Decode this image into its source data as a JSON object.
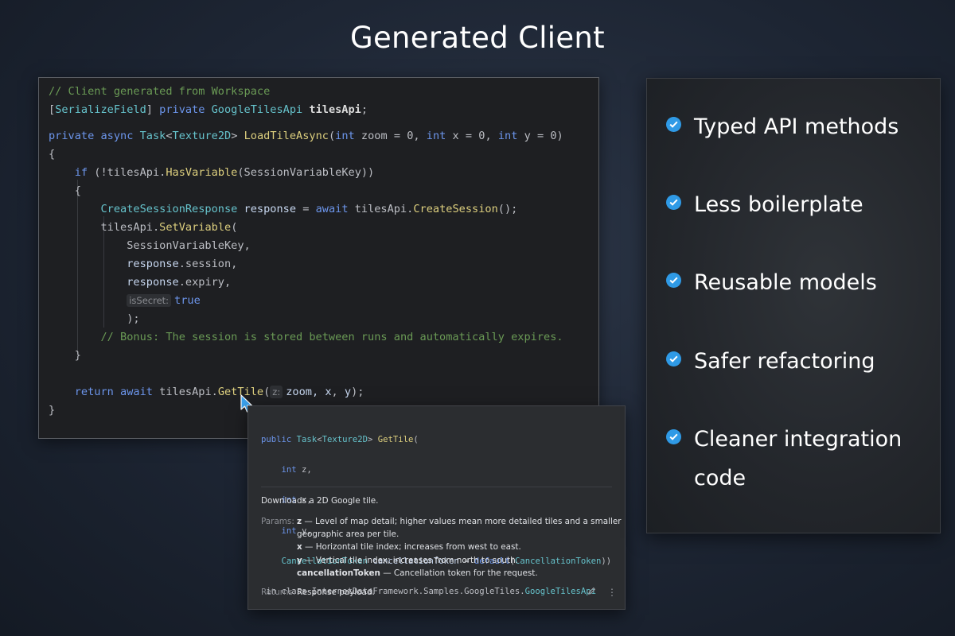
{
  "title": "Generated Client",
  "editor": {
    "l1_comment": "// Client generated from Workspace",
    "l2_open": "[",
    "l2_attr": "SerializeField",
    "l2_close": "] ",
    "l2_kw": "private",
    "l2_type": "GoogleTilesApi",
    "l2_field": "tilesApi",
    "l2_semi": ";",
    "l3_kw1": "private",
    "l3_kw2": "async",
    "l3_task": "Task",
    "l3_lt": "<",
    "l3_tex": "Texture2D",
    "l3_gt": "> ",
    "l3_fn": "LoadTileAsync",
    "l3_p1": "(",
    "l3_int1": "int",
    "l3_zoom": "zoom",
    "l3_eq0": " = 0, ",
    "l3_int2": "int",
    "l3_x": "x",
    "l3_eq1": " = 0, ",
    "l3_int3": "int",
    "l3_y": "y",
    "l3_eq2": " = 0)",
    "brace_open": "{",
    "brace_close": "}",
    "l5_if": "if",
    "l5_a": " (!tilesApi.",
    "l5_fn": "HasVariable",
    "l5_b": "(SessionVariableKey))",
    "l7_type": "CreateSessionResponse",
    "l7_var": "response",
    "l7_eq": " = ",
    "l7_await": "await",
    "l7_a": " tilesApi.",
    "l7_fn": "CreateSession",
    "l7_b": "();",
    "l8_a": "tilesApi.",
    "l8_fn": "SetVariable",
    "l8_b": "(",
    "l9": "SessionVariableKey,",
    "l10_var": "response",
    "l10_rest": ".session,",
    "l11_var": "response",
    "l11_rest": ".expiry,",
    "l12_hint": "isSecret:",
    "l12_val": "true",
    "l13": ");",
    "l14_comment": "// Bonus: The session is stored between runs and automatically expires.",
    "l16_ret": "return",
    "l16_await": "await",
    "l16_a": " tilesApi.",
    "l16_fn": "GetTile",
    "l16_b": "(",
    "l16_hint": "z:",
    "l16_c": "zoom, ",
    "l16_x": "x",
    "l16_comma": ", ",
    "l16_y": "y",
    "l16_d": ");"
  },
  "popup": {
    "s1_kw": "public",
    "s1_task": "Task",
    "s1_lt": "<",
    "s1_tex": "Texture2D",
    "s1_gt": ">",
    "s1_fn": "GetTile",
    "s1_p": "(",
    "s2_int": "int",
    "s2_n": "z,",
    "s3_int": "int",
    "s3_n": "x,",
    "s4_int": "int",
    "s4_n": "y,",
    "s5_type": "CancellationToken",
    "s5_name": "cancellationToken",
    "s5_eq": " = ",
    "s5_def": "default",
    "s5_p": "(",
    "s5_type2": "CancellationToken",
    "s5_close": "))",
    "s6_in": "in class InternetDataFramework.Samples.GoogleTiles.",
    "s6_cls": "GoogleTilesApi",
    "description": "Downloads a 2D Google tile.",
    "params_label": "Params:",
    "p_z_name": "z",
    "p_z_desc": " — Level of map detail; higher values mean more detailed tiles and a smaller",
    "p_z_desc2": "geographic area per tile.",
    "p_x_name": "x",
    "p_x_desc": " — Horizontal tile index; increases from west to east.",
    "p_y_name": "y",
    "p_y_desc": " — Vertical tile index; increases from north to south.",
    "p_ct_name": "cancellationToken",
    "p_ct_desc": " — Cancellation token for the request.",
    "returns_label": "Returns:",
    "returns_text": "Response payload.",
    "edit_icon": "pencil-icon",
    "more_icon": "more-vertical-icon"
  },
  "features": [
    "Typed API methods",
    "Less boilerplate",
    "Reusable models",
    "Safer refactoring",
    "Cleaner integration code"
  ],
  "colors": {
    "check": "#2f9ae6",
    "comment": "#6a9a55",
    "keyword": "#6c95eb",
    "type": "#66c3cc",
    "method": "#ddcf7e"
  }
}
